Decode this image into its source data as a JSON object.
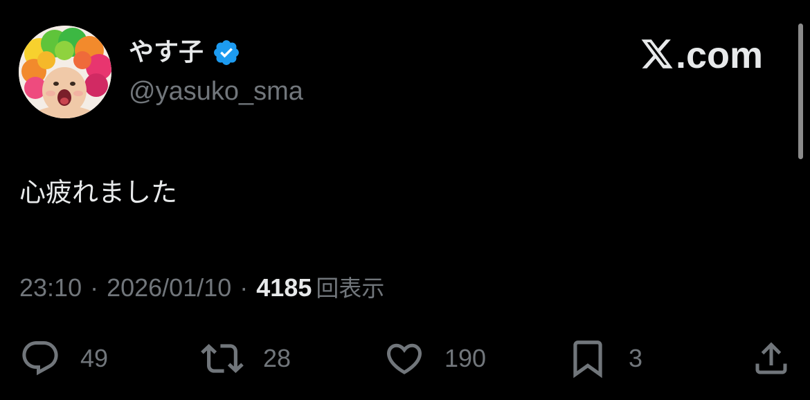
{
  "user": {
    "display_name": "やす子",
    "handle": "@yasuko_sma",
    "verified": true,
    "avatar_icon": "clown-afro-avatar"
  },
  "brand": {
    "text": ".com",
    "logo_icon": "x-logo-icon"
  },
  "tweet": {
    "text": "心疲れました",
    "time": "23:10",
    "separator": "·",
    "date": "2026/01/10",
    "views_count": "4185",
    "views_label": "回表示"
  },
  "actions": {
    "replies": {
      "icon": "reply-icon",
      "count": "49"
    },
    "reposts": {
      "icon": "repost-icon",
      "count": "28"
    },
    "likes": {
      "icon": "heart-icon",
      "count": "190"
    },
    "bookmarks": {
      "icon": "bookmark-icon",
      "count": "3"
    },
    "share": {
      "icon": "share-icon"
    }
  },
  "colors": {
    "background": "#000000",
    "primary_text": "#e7e9ea",
    "secondary_text": "#71767b",
    "verified_badge": "#1d9bf0"
  }
}
